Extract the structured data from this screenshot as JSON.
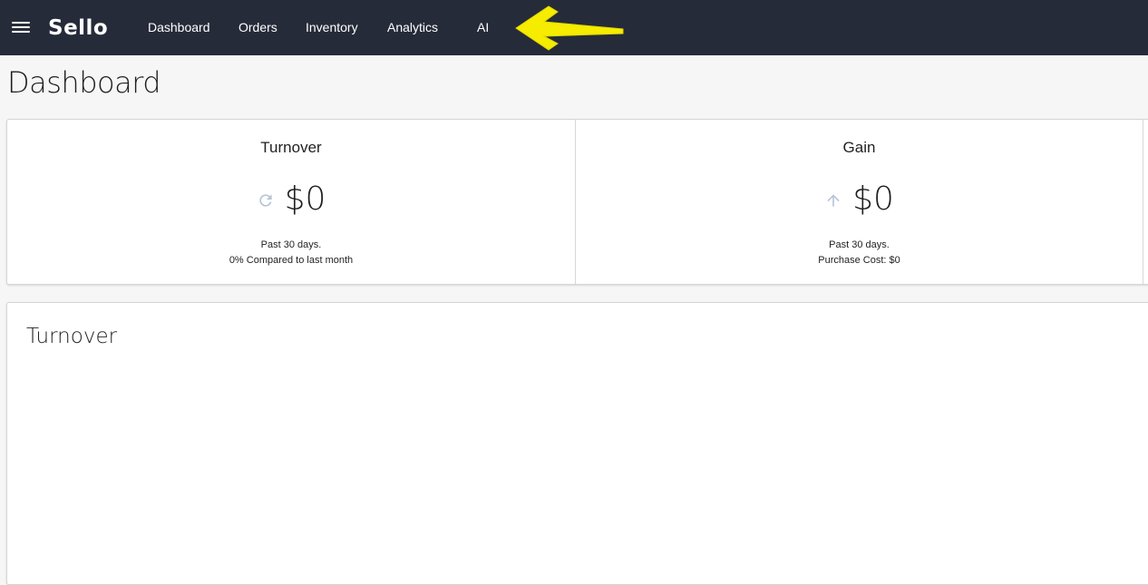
{
  "app": {
    "brand": "Sello",
    "nav": [
      {
        "label": "Dashboard"
      },
      {
        "label": "Orders"
      },
      {
        "label": "Inventory"
      },
      {
        "label": "Analytics"
      },
      {
        "label": "AI"
      }
    ]
  },
  "page": {
    "title": "Dashboard"
  },
  "stats": [
    {
      "label": "Turnover",
      "icon": "refresh-icon",
      "value": "$0",
      "line1": "Past 30 days.",
      "line2": "0% Compared to last month"
    },
    {
      "label": "Gain",
      "icon": "arrow-up-icon",
      "value": "$0",
      "line1": "Past 30 days.",
      "line2": "Purchase Cost: $0"
    }
  ],
  "chart": {
    "title": "Turnover"
  },
  "colors": {
    "topbar": "#262b3a",
    "annotation_arrow": "#f5ec00",
    "icon_muted": "#b8c4d8"
  }
}
